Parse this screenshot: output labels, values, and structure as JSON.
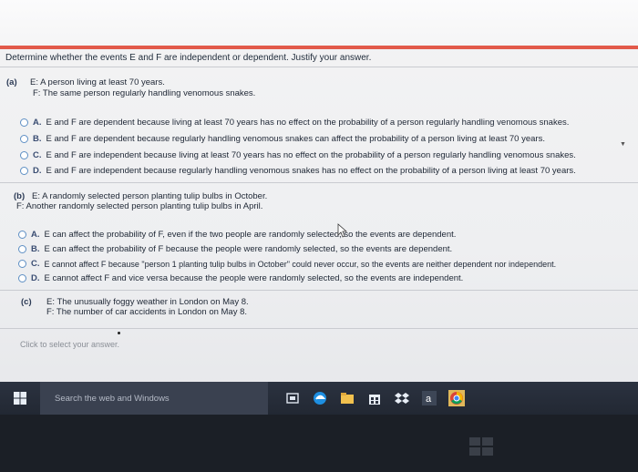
{
  "question": {
    "title": "Determine whether the events E and F are independent or dependent. Justify your answer."
  },
  "part_a": {
    "label": "(a)",
    "event_e": "E: A person living at least 70 years.",
    "event_f": "F: The same person regularly handling venomous snakes.",
    "options": [
      {
        "letter": "A.",
        "text": "E and F are dependent because living at least 70 years has no effect on the probability of a person regularly handling venomous snakes."
      },
      {
        "letter": "B.",
        "text": "E and F are dependent because regularly handling venomous snakes can affect the probability of a person living at least 70 years."
      },
      {
        "letter": "C.",
        "text": "E and F are independent because living at least 70 years has no effect on the probability of a person regularly handling venomous snakes."
      },
      {
        "letter": "D.",
        "text": "E and F are independent because regularly handling venomous snakes has no effect on the probability of a person living at least 70 years."
      }
    ]
  },
  "part_b": {
    "label": "(b)",
    "event_e": "E: A randomly selected person planting tulip bulbs in October.",
    "event_f": "F: Another randomly selected person planting tulip bulbs in April.",
    "options": [
      {
        "letter": "A.",
        "text": "E can affect the probability of F, even if the two people are randomly selected, so the events are dependent."
      },
      {
        "letter": "B.",
        "text": "E can affect the probability of F because the people were randomly selected, so the events are dependent."
      },
      {
        "letter": "C.",
        "text": "E cannot affect F because \"person 1 planting tulip bulbs in October\" could never occur, so the events are neither dependent nor independent."
      },
      {
        "letter": "D.",
        "text": "E cannot affect F and vice versa because the people were randomly selected, so the events are independent."
      }
    ]
  },
  "part_c": {
    "label": "(c)",
    "event_e": "E: The unusually foggy weather in London on May 8.",
    "event_f": "F: The number of car accidents in London on May 8."
  },
  "answer_prompt": "Click to select your answer.",
  "taskbar": {
    "search_placeholder": "Search the web and Windows",
    "icons": [
      "windows-start-icon",
      "task-view-icon",
      "edge-icon",
      "file-explorer-icon",
      "store-icon",
      "dropbox-icon",
      "amazon-icon",
      "chrome-icon"
    ]
  },
  "colors": {
    "accent_line": "#e25a4a",
    "radio_border": "#5e8fc4",
    "taskbar": "#2b3240"
  }
}
